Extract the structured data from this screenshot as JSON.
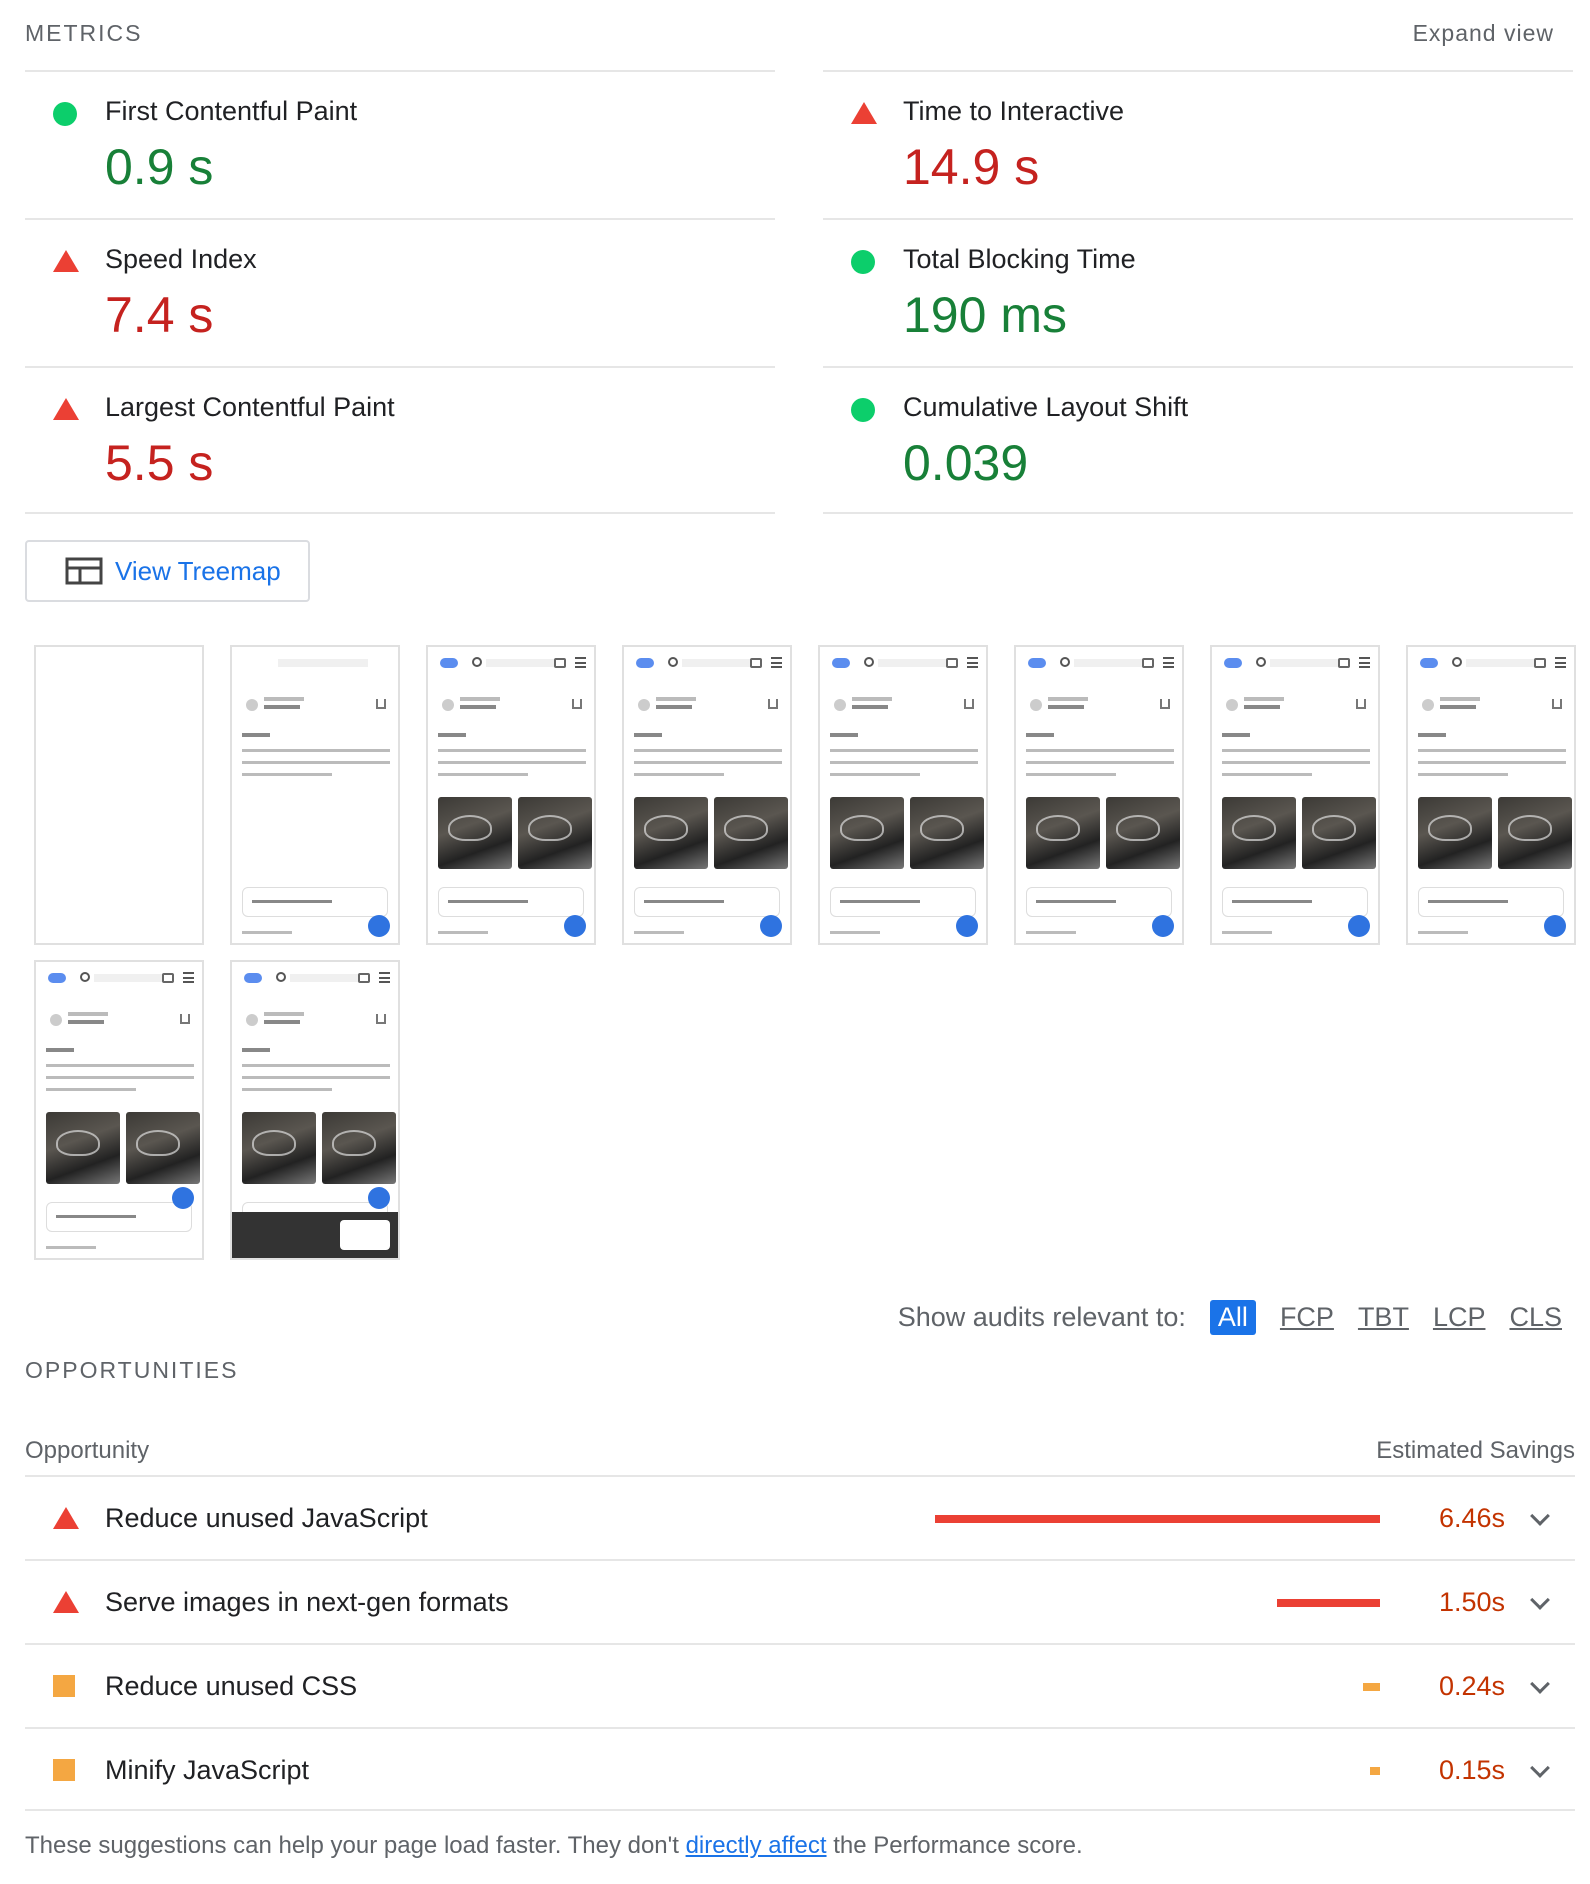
{
  "metrics_section": {
    "header": "METRICS",
    "expand_label": "Expand view",
    "left": [
      {
        "title": "First Contentful Paint",
        "value": "0.9 s",
        "status": "pass"
      },
      {
        "title": "Speed Index",
        "value": "7.4 s",
        "status": "fail"
      },
      {
        "title": "Largest Contentful Paint",
        "value": "5.5 s",
        "status": "fail"
      }
    ],
    "right": [
      {
        "title": "Time to Interactive",
        "value": "14.9 s",
        "status": "fail"
      },
      {
        "title": "Total Blocking Time",
        "value": "190 ms",
        "status": "pass"
      },
      {
        "title": "Cumulative Layout Shift",
        "value": "0.039",
        "status": "pass"
      }
    ]
  },
  "treemap": {
    "label": "View Treemap"
  },
  "filter": {
    "label": "Show audits relevant to:",
    "options": [
      "All",
      "FCP",
      "TBT",
      "LCP",
      "CLS"
    ],
    "selected": "All"
  },
  "opportunities": {
    "header": "OPPORTUNITIES",
    "col_left": "Opportunity",
    "col_right": "Estimated Savings",
    "items": [
      {
        "title": "Reduce unused JavaScript",
        "savings": "6.46s",
        "level": "fail",
        "savings_value": 6.46
      },
      {
        "title": "Serve images in next-gen formats",
        "savings": "1.50s",
        "level": "fail",
        "savings_value": 1.5
      },
      {
        "title": "Reduce unused CSS",
        "savings": "0.24s",
        "level": "average",
        "savings_value": 0.24
      },
      {
        "title": "Minify JavaScript",
        "savings": "0.15s",
        "level": "average",
        "savings_value": 0.15
      }
    ]
  },
  "footer": {
    "before": "These suggestions can help your page load faster. They don't ",
    "link": "directly affect",
    "after": " the Performance score."
  },
  "colors": {
    "pass": "#0cce6b",
    "fail": "#eb4034",
    "average": "#f4a742",
    "accent": "#1a73e8"
  }
}
